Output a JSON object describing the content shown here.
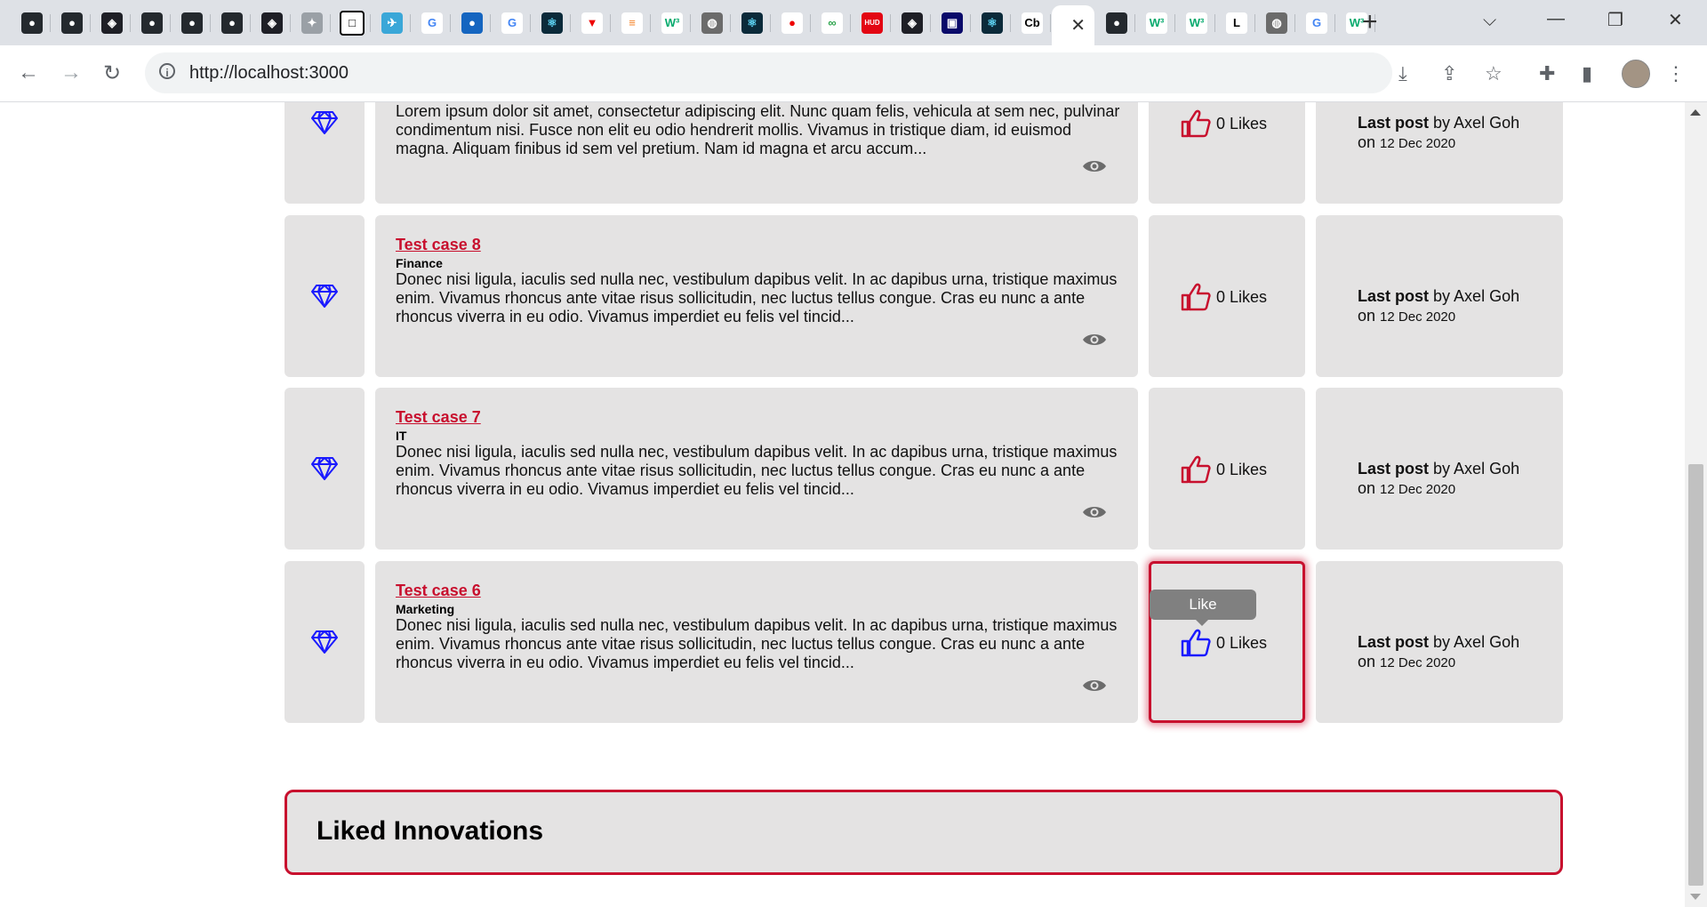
{
  "browser": {
    "url": "http://localhost:3000",
    "active_tab_favicon": "Cb",
    "tab_icons": [
      "github-icon",
      "github-icon",
      "codepen-icon",
      "github-icon",
      "github-icon",
      "github-icon",
      "codepen-icon",
      "puzzle-icon",
      "square-icon",
      "bird-icon",
      "google-icon",
      "avatar-icon",
      "google-icon",
      "react-icon",
      "vercel-icon",
      "stackoverflow-icon",
      "w3schools-icon",
      "globe-icon",
      "react-icon",
      "redhat-icon",
      "gitbook-icon",
      "hud-icon",
      "codepen-icon",
      "dev-icon",
      "react-icon",
      "cb-icon",
      "github-icon",
      "w3schools-icon",
      "w3schools-icon",
      "l-icon",
      "globe-icon",
      "google-icon",
      "w3schools-icon"
    ],
    "tab_glyphs": {
      "w3": "W³",
      "l": "L",
      "g": "G",
      "cb": "Cb",
      "hud": "HUD"
    }
  },
  "posts": [
    {
      "title": "",
      "category": "",
      "description": "Lorem ipsum dolor sit amet, consectetur adipiscing elit. Nunc quam felis, vehicula at sem nec, pulvinar condimentum nisi. Fusce non elit eu odio hendrerit mollis. Vivamus in tristique diam, id euismod magna. Aliquam finibus id sem vel pretium. Nam id magna et arcu accum...",
      "likes": "0 Likes",
      "last_post_label": "Last post",
      "last_post_by": "by Axel Goh",
      "last_post_on": "on",
      "last_post_date": "12 Dec 2020"
    },
    {
      "title": "Test case 8",
      "category": "Finance",
      "description": "Donec nisi ligula, iaculis sed nulla nec, vestibulum dapibus velit. In ac dapibus urna, tristique maximus enim. Vivamus rhoncus ante vitae risus sollicitudin, nec luctus tellus congue. Cras eu nunc a ante rhoncus viverra in eu odio. Vivamus imperdiet eu felis vel tincid...",
      "likes": "0 Likes",
      "last_post_label": "Last post",
      "last_post_by": "by Axel Goh",
      "last_post_on": "on",
      "last_post_date": "12 Dec 2020"
    },
    {
      "title": "Test case 7",
      "category": "IT",
      "description": "Donec nisi ligula, iaculis sed nulla nec, vestibulum dapibus velit. In ac dapibus urna, tristique maximus enim. Vivamus rhoncus ante vitae risus sollicitudin, nec luctus tellus congue. Cras eu nunc a ante rhoncus viverra in eu odio. Vivamus imperdiet eu felis vel tincid...",
      "likes": "0 Likes",
      "last_post_label": "Last post",
      "last_post_by": "by Axel Goh",
      "last_post_on": "on",
      "last_post_date": "12 Dec 2020"
    },
    {
      "title": "Test case 6",
      "category": "Marketing",
      "description": "Donec nisi ligula, iaculis sed nulla nec, vestibulum dapibus velit. In ac dapibus urna, tristique maximus enim. Vivamus rhoncus ante vitae risus sollicitudin, nec luctus tellus congue. Cras eu nunc a ante rhoncus viverra in eu odio. Vivamus imperdiet eu felis vel tincid...",
      "likes": "0 Likes",
      "last_post_label": "Last post",
      "last_post_by": "by Axel Goh",
      "last_post_on": "on",
      "last_post_date": "12 Dec 2020",
      "tooltip": "Like"
    }
  ],
  "liked_section": {
    "heading": "Liked Innovations"
  },
  "colors": {
    "accent": "#c8102e",
    "card": "#e4e3e3",
    "diamond": "#1a1aff",
    "thumb": "#c8102e",
    "thumb_hover": "#1a1aff"
  }
}
